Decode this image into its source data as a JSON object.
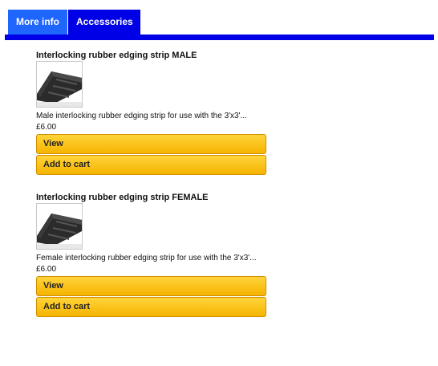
{
  "tabs": [
    {
      "label": "More info"
    },
    {
      "label": "Accessories"
    }
  ],
  "products": [
    {
      "title": "Interlocking rubber edging strip MALE",
      "description": "Male interlocking rubber edging strip for use with the 3'x3'...",
      "price": "£6.00",
      "view_label": "View",
      "cart_label": "Add to cart"
    },
    {
      "title": "Interlocking rubber edging strip FEMALE",
      "description": "Female interlocking rubber edging strip for use with the 3'x3'...",
      "price": "£6.00",
      "view_label": "View",
      "cart_label": "Add to cart"
    }
  ],
  "colors": {
    "tab_active": "#0000e6",
    "tab_inactive": "#1f66ff",
    "button": "#f5b400"
  }
}
